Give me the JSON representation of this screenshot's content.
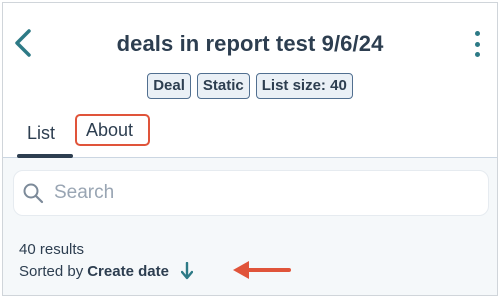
{
  "header": {
    "title": "deals in report test 9/6/24"
  },
  "badges": [
    "Deal",
    "Static",
    "List size: 40"
  ],
  "tabs": [
    {
      "label": "List",
      "active": true
    },
    {
      "label": "About",
      "active": false
    }
  ],
  "search": {
    "placeholder": "Search"
  },
  "results": {
    "count_text": "40 results",
    "sort_prefix": "Sorted by",
    "sort_field": "Create date"
  },
  "icons": {
    "back": "chevron-left-icon",
    "menu": "kebab-icon",
    "search": "search-icon",
    "sort": "arrow-down-icon"
  },
  "colors": {
    "accent_teal": "#2d7a86",
    "annotation": "#e0543a",
    "text": "#2d3e50",
    "panel_bg": "#f5f8fa"
  }
}
